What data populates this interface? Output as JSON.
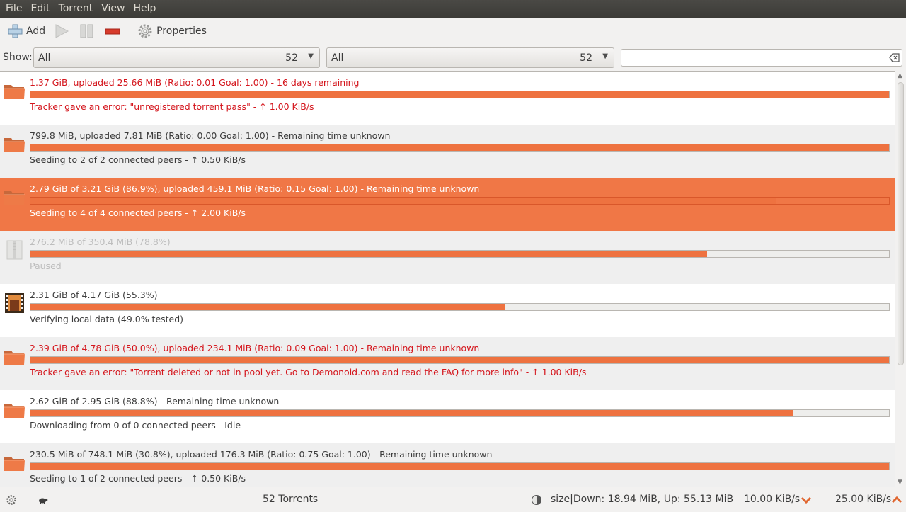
{
  "menu": [
    "File",
    "Edit",
    "Torrent",
    "View",
    "Help"
  ],
  "toolbar": {
    "add_label": "Add",
    "properties_label": "Properties",
    "icons": [
      "add-icon",
      "play-icon",
      "pause-icon",
      "remove-icon",
      "gear-icon"
    ]
  },
  "filter": {
    "show_label": "Show:",
    "combo1": {
      "label": "All",
      "count": "52"
    },
    "combo2": {
      "label": "All",
      "count": "52"
    },
    "search_value": ""
  },
  "torrents": [
    {
      "line1": "1.37 GiB, uploaded 25.66 MiB (Ratio: 0.01 Goal: 1.00) - 16 days remaining",
      "line2": "Tracker gave an error: \"unregistered torrent pass\" - ↑ 1.00 KiB/s",
      "progress": 1.0,
      "state": "error",
      "icon": "folder-icon"
    },
    {
      "line1": "799.8 MiB, uploaded 7.81 MiB (Ratio: 0.00 Goal: 1.00) - Remaining time unknown",
      "line2": "Seeding to 2 of 2 connected peers - ↑ 0.50 KiB/s",
      "progress": 1.0,
      "state": "normal",
      "icon": "folder-icon"
    },
    {
      "line1": "2.79 GiB of 3.21 GiB (86.9%), uploaded 459.1 MiB (Ratio: 0.15 Goal: 1.00) - Remaining time unknown",
      "line2": "Seeding to 4 of 4 connected peers - ↑ 2.00 KiB/s",
      "progress": 0.869,
      "state": "selected",
      "icon": "folder-icon"
    },
    {
      "line1": "276.2 MiB of 350.4 MiB (78.8%)",
      "line2": "Paused",
      "progress": 0.788,
      "state": "paused",
      "icon": "archive-icon"
    },
    {
      "line1": "2.31 GiB of 4.17 GiB (55.3%)",
      "line2": "Verifying local data (49.0% tested)",
      "progress": 0.553,
      "state": "normal",
      "icon": "video-icon"
    },
    {
      "line1": "2.39 GiB of 4.78 GiB (50.0%), uploaded 234.1 MiB (Ratio: 0.09 Goal: 1.00) - Remaining time unknown",
      "line2": "Tracker gave an error: \"Torrent deleted or not in pool yet. Go to Demonoid.com and read the FAQ for more info\" - ↑ 1.00 KiB/s",
      "progress": 1.0,
      "state": "error",
      "icon": "folder-icon"
    },
    {
      "line1": "2.62 GiB of 2.95 GiB (88.8%) - Remaining time unknown",
      "line2": "Downloading from 0 of 0 connected peers - Idle",
      "progress": 0.888,
      "state": "normal",
      "icon": "folder-icon"
    },
    {
      "line1": "230.5 MiB of 748.1 MiB (30.8%), uploaded 176.3 MiB (Ratio: 0.75 Goal: 1.00) - Remaining time unknown",
      "line2": "Seeding to 1 of 2 connected peers - ↑ 0.50 KiB/s",
      "progress": 1.0,
      "state": "normal",
      "icon": "folder-icon"
    }
  ],
  "status": {
    "count": "52 Torrents",
    "stats": "size|Down: 18.94 MiB, Up: 55.13 MiB",
    "down_limit": "10.00 KiB/s",
    "up_limit": "25.00 KiB/s"
  },
  "colors": {
    "accent": "#ee7240",
    "error": "#d4151c",
    "selected": "#f07746"
  }
}
